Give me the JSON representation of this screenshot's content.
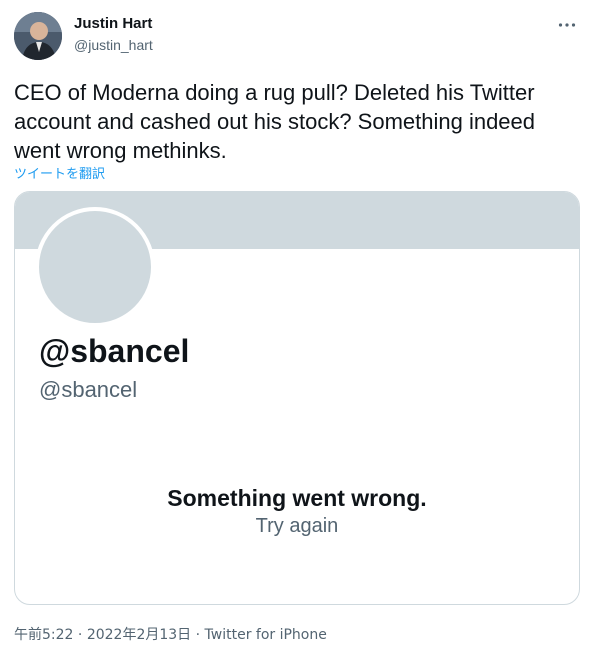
{
  "author": {
    "name": "Justin Hart",
    "handle": "@justin_hart"
  },
  "tweet": {
    "text": "CEO of Moderna doing a rug pull? Deleted his Twitter account and cashed out his stock? Something indeed went wrong methinks.",
    "translate_label": "ツイートを翻訳"
  },
  "embedded_card": {
    "display_name": "@sbancel",
    "handle": "@sbancel",
    "error_title": "Something went wrong.",
    "retry_label": "Try again"
  },
  "meta": {
    "time": "午前5:22",
    "separator1": " · ",
    "date": "2022年2月13日",
    "separator2": " · ",
    "source": "Twitter for iPhone"
  },
  "colors": {
    "link": "#1d9bf0",
    "muted_text": "#536471",
    "card_placeholder": "#cfd9de"
  },
  "icons": {
    "more": "more-horizontal-icon"
  }
}
